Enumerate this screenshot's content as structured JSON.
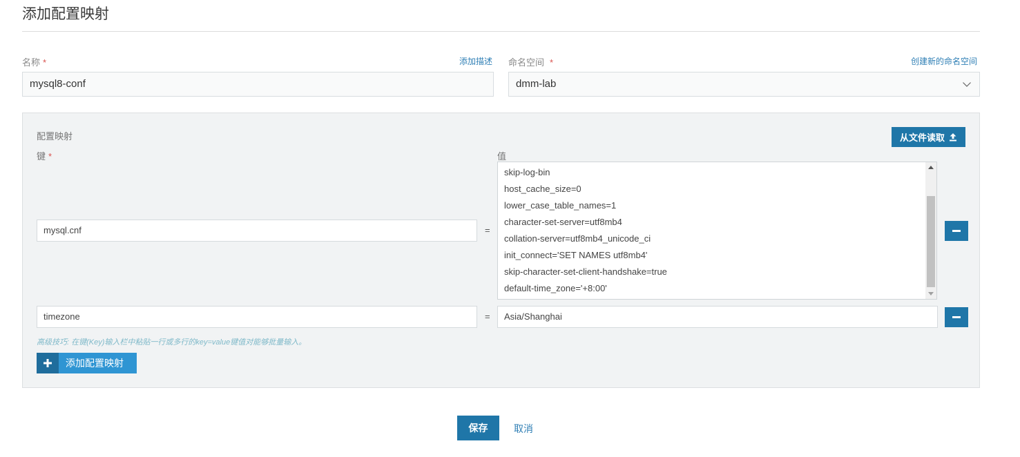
{
  "page": {
    "title": "添加配置映射"
  },
  "form": {
    "name_label": "名称",
    "required_mark": "*",
    "add_description_link": "添加描述",
    "name_value": "mysql8-conf",
    "namespace_label": "命名空间",
    "create_namespace_link": "创建新的命名空间",
    "namespace_value": "dmm-lab"
  },
  "config_map": {
    "section_label": "配置映射",
    "read_from_file_label": "从文件读取",
    "key_label": "键",
    "value_label": "值",
    "equals": "=",
    "entries": [
      {
        "key": "mysql.cnf",
        "value_lines": [
          "skip-log-bin",
          "host_cache_size=0",
          "lower_case_table_names=1",
          "character-set-server=utf8mb4",
          "collation-server=utf8mb4_unicode_ci",
          "init_connect='SET NAMES utf8mb4'",
          "skip-character-set-client-handshake=true",
          "default-time_zone='+8:00'"
        ]
      },
      {
        "key": "timezone",
        "value": "Asia/Shanghai"
      }
    ],
    "hint": "高级技巧: 在键(Key)输入栏中粘贴一行或多行的key=value键值对能够批量输入。",
    "add_button_label": "添加配置映射"
  },
  "footer": {
    "save_label": "保存",
    "cancel_label": "取消"
  },
  "colors": {
    "primary": "#1f76a8",
    "link": "#2f7fb5",
    "required": "#d9534f",
    "panel_bg": "#f1f3f4"
  },
  "icons": [
    "chevron-down-icon",
    "upload-icon",
    "minus-icon",
    "plus-icon",
    "scroll-up-arrow-icon",
    "scroll-down-arrow-icon"
  ]
}
